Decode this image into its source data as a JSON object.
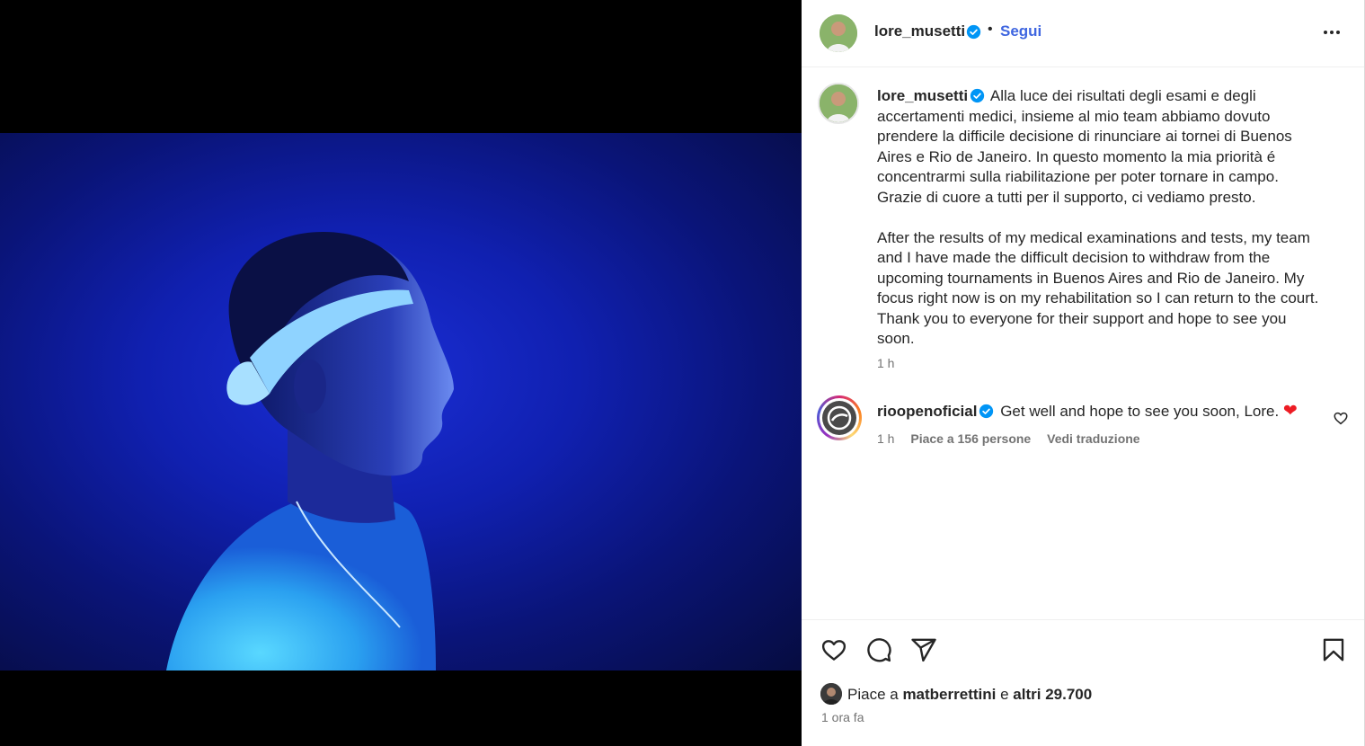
{
  "post": {
    "username": "lore_musetti",
    "follow_label": "Segui",
    "dot": "•",
    "caption_italian": "Alla luce dei risultati degli esami e degli accertamenti medici, insieme al mio team abbiamo dovuto prendere la difficile decisione di rinunciare ai tornei di Buenos Aires e Rio de Janeiro. In questo momento la mia priorità é concentrarmi sulla riabilitazione per poter tornare in campo. Grazie di cuore a tutti per il supporto, ci vediamo presto.",
    "caption_english": "After the results of my medical examinations and tests, my team and I have made the difficult decision to withdraw from the upcoming tournaments in Buenos Aires and Rio de Janeiro. My focus right now is on my rehabilitation so I can return to the court. Thank you to everyone for their support and hope to see you soon.",
    "caption_time": "1 h"
  },
  "comment": {
    "username": "rioopenoficial",
    "text": "Get well and hope to see you soon, Lore.",
    "time": "1 h",
    "likes": "Piace a 156 persone",
    "translate": "Vedi traduzione"
  },
  "footer": {
    "likes_prefix": "Piace a",
    "liked_by": "matberrettini",
    "likes_middle": "e",
    "likes_others": "altri 29.700",
    "posted": "1 ora fa"
  },
  "colors": {
    "accent": "#3f66e0",
    "verified": "#0095f6",
    "heart": "#ed1c24",
    "photo_blue": "#1b2fd8"
  },
  "icons": [
    "verified-icon",
    "more-icon",
    "heart-icon",
    "comment-icon",
    "share-icon",
    "bookmark-icon"
  ]
}
